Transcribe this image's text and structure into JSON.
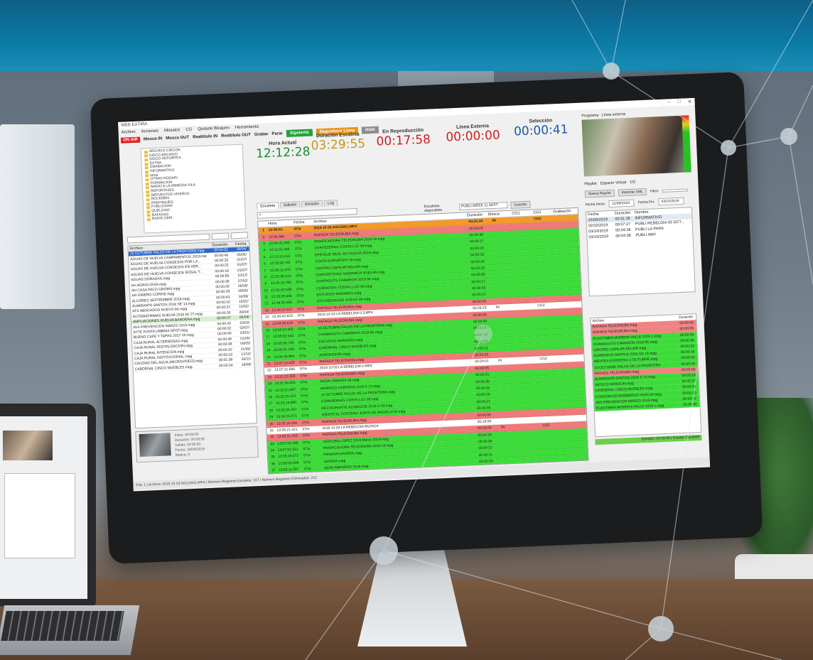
{
  "app": {
    "title": "WEB EXTIRA",
    "menu": [
      "Archivo",
      "Acciones",
      "Mosaico",
      "CG",
      "Quitarle Bloqueo",
      "Herramienta"
    ],
    "window_controls": [
      "–",
      "□",
      "✕"
    ]
  },
  "toolbar": {
    "onair": "ON AIR",
    "mosca_in": "Mosca IN",
    "mosca_out": "Mosca OUT",
    "realtitulo_in": "Realtitulo IN",
    "realtitulo_out": "Realtitulo OUT",
    "grabar": "Grabar",
    "parar": "Parar",
    "siguiente": "Siguiente",
    "reproducir_linea": "Reproducir Linea",
    "hold": "Hold"
  },
  "clocks": {
    "hora_actual": {
      "label": "Hora Actual",
      "value": "12:12:28",
      "color": "#1f8a2a"
    },
    "duracion_escaleta": {
      "label": "Duración Escaleta",
      "value": "03:29:55",
      "color": "#c7951a"
    },
    "en_reproduccion": {
      "label": "En Reproducción",
      "value": "00:17:58",
      "color": "#cc1f1f"
    },
    "linea_externa": {
      "label": "Línea Externa",
      "value": "00:00:00",
      "color": "#cc1f1f"
    },
    "seleccion": {
      "label": "Selección",
      "value": "00:00:41",
      "color": "#1a5aa6"
    }
  },
  "tree": [
    "ARCHIVO CIRCON",
    "DISCO ARCHIVO",
    "DISCO DEPORTES",
    "EXTRA",
    "GRABACION",
    "INFORMATIVO",
    "otros",
    "OTRAS ROGAIN",
    "PORMACION",
    "RADIO A LA ARMEDIA VILA",
    "REPORTAJES",
    "REPUESTOS VIVERUS",
    "ROCEMBO",
    "PREFINAJES",
    "PUBLICIDAD",
    "QUELIDAD",
    "RAFAGAS",
    "RADIO GEM"
  ],
  "left_list": {
    "headers": [
      "Archivo",
      "Duración",
      "Fecha"
    ],
    "rows": [
      {
        "name": "10 OCTUBRE PALOS DE LA FRONTERA.mpg",
        "dur": "00:00:50",
        "date": "29/04/",
        "state": "sel"
      },
      {
        "name": "AGUAS DE HUELVA CAMPAMENTOS 2018.mp4",
        "dur": "00:00:48",
        "date": "05/05/",
        "state": ""
      },
      {
        "name": "AGUAS DE HUELVA CONSEJOS POR LA...",
        "dur": "00:00:32",
        "date": "01/07/",
        "state": ""
      },
      {
        "name": "AGUAS DE HUELVA CONSEJOS EN VER...",
        "dur": "00:00:22",
        "date": "01/07/",
        "state": ""
      },
      {
        "name": "AGUAS DE HUELVA CONSEJOS ROSAL T...",
        "dur": "00:00:18",
        "date": "01/07/",
        "state": ""
      },
      {
        "name": "AGUAS DORADAS.mpg",
        "dur": "00:00:59",
        "date": "10/12/",
        "state": ""
      },
      {
        "name": "AH AGROLOGIA.mpg",
        "dur": "00:00:38",
        "date": "27/02/",
        "state": ""
      },
      {
        "name": "AH CASA PACO GROMS.mpg",
        "dur": "00:00:26",
        "date": "05/05/",
        "state": ""
      },
      {
        "name": "AH GINERO CORKIE.mpg",
        "dur": "00:00:29",
        "date": "05/05/",
        "state": ""
      },
      {
        "name": "ALCORES SEPTIEMBRE 2018.mpg",
        "dur": "00:00:43",
        "date": "16/09/",
        "state": ""
      },
      {
        "name": "ALMIRANTA SANTOS 2016 SE 14.mpg",
        "dur": "00:00:16",
        "date": "15/02/",
        "state": ""
      },
      {
        "name": "ATS ABOGADOS NUEVO 9K.mpg",
        "dur": "00:00:21",
        "date": "10/02/",
        "state": ""
      },
      {
        "name": "AUTOMATRIMAS HUELVA 2016 AV 27.mpg",
        "dur": "00:00:30",
        "date": "20/04/",
        "state": ""
      },
      {
        "name": "AMPLIACIONES HUELVA BANDERA.mpg",
        "dur": "00:00:27",
        "date": "06/04/",
        "state": "hl"
      },
      {
        "name": "AVS PREVENCION MARZO 2018.mpg",
        "dur": "00:00:42",
        "date": "15/03/",
        "state": ""
      },
      {
        "name": "AYTE PUNTA UMBRIA SPOT.mpg",
        "dur": "00:00:32",
        "date": "02/07/",
        "state": ""
      },
      {
        "name": "BUENO CAFE Y TAPAS 2017 VII.mpg",
        "dur": "00:00:40",
        "date": "23/01/",
        "state": ""
      },
      {
        "name": "CAJA RURAL ALTERNOSAS.mpg",
        "dur": "00:00:48",
        "date": "01/05/",
        "state": ""
      },
      {
        "name": "CAJA RURAL DIGITALIZACION.mpg",
        "dur": "00:00:38",
        "date": "06/05/",
        "state": ""
      },
      {
        "name": "CAJA RURAL INTENCION.mpg",
        "dur": "00:00:20",
        "date": "21/05/",
        "state": ""
      },
      {
        "name": "CAJA RURAL INSTITUCIONAL.mpg",
        "dur": "00:00:19",
        "date": "11/10/",
        "state": ""
      },
      {
        "name": "CALIDAD DEL AGUA (MICROVIDEO).mpg",
        "dur": "00:01:38",
        "date": "26/11/",
        "state": ""
      },
      {
        "name": "CARDENAL CINCO MUEBLES.mpg",
        "dur": "00:00:34",
        "date": "18/09/",
        "state": ""
      }
    ]
  },
  "preview": {
    "lines": [
      "Inicio: 00:00:00",
      "Duración: 00:00:50",
      "Salida: 00:00:50",
      "Fecha: 29/04/2019",
      "Mosca: 0"
    ]
  },
  "tabs": [
    "Escaleta",
    "Edición",
    "Emisión",
    "Log"
  ],
  "main_search": {
    "placeholder": "",
    "label": "Escaletas disponibles",
    "combo": "PUBLI-WEEK 11.SEPT",
    "button": "Guardar"
  },
  "grid": {
    "headers": [
      "",
      "Hora",
      "Fecha",
      "Archivo",
      "Duración",
      "Mosca",
      "CG1",
      "CG2",
      "Grabación"
    ],
    "rows": [
      {
        "n": "1",
        "h": "12:06:51",
        "f": "07/a",
        "a": "2019 10 03 A0112601.MP4",
        "d": "00:21:34",
        "m": "IN",
        "c1": "",
        "c2": "CG2",
        "g": "",
        "s": "orange"
      },
      {
        "n": "2",
        "h": "12:06:366",
        "f": "07/a",
        "a": "RAFAGA TELEONUBA.mpg",
        "d": "00:00:04",
        "m": "",
        "c1": "",
        "c2": "",
        "g": "",
        "s": "red"
      },
      {
        "n": "3",
        "h": "12:08:31.059",
        "f": "07/a",
        "a": "PANIFICADORA TELEONUBA 2018-19.mpg",
        "d": "00:00:36",
        "m": "",
        "c1": "",
        "c2": "",
        "g": "",
        "s": "green"
      },
      {
        "n": "4",
        "h": "12:11:01.406",
        "f": "07/a",
        "a": "CERVEZERAS COSTA LUZ 08.mpg",
        "d": "00:00:17",
        "m": "",
        "c1": "",
        "c2": "",
        "g": "",
        "s": "green"
      },
      {
        "n": "5",
        "h": "12:13:13.415",
        "f": "07/a",
        "a": "EPIFIDUE REAL DE HUELVA 2019.mpg",
        "d": "00:00:20",
        "m": "",
        "c1": "",
        "c2": "",
        "g": "",
        "s": "green"
      },
      {
        "n": "6",
        "h": "12:15:58.782",
        "f": "07/a",
        "a": "COSTA DORSPORT 09.mpg",
        "d": "00:00:32",
        "m": "",
        "c1": "",
        "c2": "",
        "g": "",
        "s": "green"
      },
      {
        "n": "7",
        "h": "12:20:11.075",
        "f": "07/a",
        "a": "CENTRO CAPILAR BELAIR.mpg",
        "d": "00:00:24",
        "m": "",
        "c1": "",
        "c2": "",
        "g": "",
        "s": "green"
      },
      {
        "n": "8",
        "h": "12:22:30.514",
        "f": "07/a",
        "a": "CONVERTIDOS SANDWICH HUELVA.mpg",
        "d": "00:00:23",
        "m": "",
        "c1": "",
        "c2": "",
        "g": "",
        "s": "green"
      },
      {
        "n": "9",
        "h": "12:25:18.795",
        "f": "07/a",
        "a": "CHAPAGUTS CAMARON 2018 9K.mpg",
        "d": "00:00:36",
        "m": "",
        "c1": "",
        "c2": "",
        "g": "",
        "s": "green"
      },
      {
        "n": "10",
        "h": "12:31:42.538",
        "f": "07/a",
        "a": "CORNISTAS COSTA LLUZ 09.mpg",
        "d": "00:00:17",
        "m": "",
        "c1": "",
        "c2": "",
        "g": "",
        "s": "green"
      },
      {
        "n": "11",
        "h": "12:33:28.646",
        "f": "07/a",
        "a": "ESTUDIOS MAÑANES.mpg",
        "d": "00:00:30",
        "m": "",
        "c1": "",
        "c2": "",
        "g": "",
        "s": "green"
      },
      {
        "n": "12",
        "h": "12:34:32.856",
        "f": "07/a",
        "a": "STO MEDIAGOS SUEXO 09.mpg",
        "d": "00:00:21",
        "m": "",
        "c1": "",
        "c2": "",
        "g": "",
        "s": "green"
      },
      {
        "n": "13",
        "h": "12:34:37.817",
        "f": "07/a",
        "a": "RAFAGA TELEONUBA.mpg",
        "d": "00:00:05",
        "m": "",
        "c1": "",
        "c2": "",
        "g": "",
        "s": "red"
      },
      {
        "n": "14",
        "h": "12:34:42.623",
        "f": "07/a",
        "a": "2019 10 03 LA REBELDIA 0 3.MP4",
        "d": "00:29:23",
        "m": "IN",
        "c1": "",
        "c2": "CG2",
        "g": "",
        "s": "white"
      },
      {
        "n": "15",
        "h": "13:04:05.616",
        "f": "07/a",
        "a": "RAFAGA TELEONUBA.mpg",
        "d": "00:00:05",
        "m": "",
        "c1": "",
        "c2": "",
        "g": "",
        "s": "red"
      },
      {
        "n": "16",
        "h": "13:04:13.405",
        "f": "07/a",
        "a": "10 OCTUBRE PALOS DE LA FRONTERA.mpg",
        "d": "00:00:49",
        "m": "",
        "c1": "",
        "c2": "",
        "g": "",
        "s": "green"
      },
      {
        "n": "17",
        "h": "13:05:02.543",
        "f": "07/a",
        "a": "CHAMAGUTS CAMARON 2018 9K.mpg",
        "d": "00:00:36",
        "m": "",
        "c1": "",
        "c2": "",
        "g": "",
        "s": "green"
      },
      {
        "n": "18",
        "h": "13:05:38.728",
        "f": "07/a",
        "a": "ESCUDOS MAÑANES.mpg",
        "d": "00:00:23",
        "m": "",
        "c1": "",
        "c2": "",
        "g": "",
        "s": "green"
      },
      {
        "n": "19",
        "h": "13:06:01.246",
        "f": "07/a",
        "a": "CARDENAL CINCO MUEBLES.mpg",
        "d": "00:00:34",
        "m": "",
        "c1": "",
        "c2": "",
        "g": "",
        "s": "green"
      },
      {
        "n": "20",
        "h": "13:06:35.994",
        "f": "07/a",
        "a": "AVIRONSERA.mpg",
        "d": "00:00:21",
        "m": "",
        "c1": "",
        "c2": "",
        "g": "",
        "s": "green"
      },
      {
        "n": "21",
        "h": "13:07:14.635",
        "f": "07/a",
        "a": "RAFAGA TELEONUBA.mpg",
        "d": "00:00:05",
        "m": "",
        "c1": "",
        "c2": "",
        "g": "",
        "s": "red"
      },
      {
        "n": "22",
        "h": "13:07:21.586",
        "f": "07/a",
        "a": "2019 10 03 LA REBELDIA 0 MP4",
        "d": "00:24:01",
        "m": "IN",
        "c1": "",
        "c2": "CG2",
        "g": "",
        "s": "white"
      },
      {
        "n": "23",
        "h": "13:31:22.355",
        "f": "07/a",
        "a": "RAFAGA TELEONUBA.mpg",
        "d": "00:00:05",
        "m": "",
        "c1": "",
        "c2": "",
        "g": "",
        "s": "red"
      },
      {
        "n": "24",
        "h": "13:31:30.601",
        "f": "07/a",
        "a": "MOVA UMANDA 09.mpg",
        "d": "00:00:21",
        "m": "",
        "c1": "",
        "c2": "",
        "g": "",
        "s": "green"
      },
      {
        "n": "25",
        "h": "13:31:51.867",
        "f": "07/a",
        "a": "MARISCO CARPENA 2018 S 13.mpg",
        "d": "00:00:35",
        "m": "",
        "c1": "",
        "c2": "",
        "g": "",
        "s": "green"
      },
      {
        "n": "26",
        "h": "13:32:26.151",
        "f": "07/a",
        "a": "10 OCTUBRE PALOS DE LA FRONTERA.mpg",
        "d": "00:00:49",
        "m": "",
        "c1": "",
        "c2": "",
        "g": "",
        "s": "green"
      },
      {
        "n": "27",
        "h": "13:33:16.880",
        "f": "07/a",
        "a": "COMANDINAS COSTA LUZ 09.mpg",
        "d": "00:00:18",
        "m": "",
        "c1": "",
        "c2": "",
        "g": "",
        "s": "green"
      },
      {
        "n": "28",
        "h": "13:33:34.307",
        "f": "07/a",
        "a": "RESTAURANTE AZABACHE 2018 S 03.mpg",
        "d": "00:00:21",
        "m": "",
        "c1": "",
        "c2": "",
        "g": "",
        "s": "green"
      },
      {
        "n": "29",
        "h": "13:34:15.071",
        "f": "07/a",
        "a": "DIENTE EL COSTERO JUNTA DE ANDALUCIA.mpg",
        "d": "00:00:35",
        "m": "",
        "c1": "",
        "c2": "",
        "g": "",
        "s": "green"
      },
      {
        "n": "30",
        "h": "13:35:16.006",
        "f": "07/a",
        "a": "RAFAGA TELEONUBA.mpg",
        "d": "00:00:05",
        "m": "",
        "c1": "",
        "c2": "",
        "g": "",
        "s": "red"
      },
      {
        "n": "31",
        "h": "13:35:21.321",
        "f": "07/a",
        "a": "2019 10 03 LA REBELDIA-MUSICA",
        "d": "00:19:59",
        "m": "",
        "c1": "",
        "c2": "",
        "g": "",
        "s": "white"
      },
      {
        "n": "32",
        "h": "13:55:21.319",
        "f": "07/a",
        "a": "RAFAGA TELEONUBA.mpg",
        "d": "00:02:05",
        "m": "IN",
        "c1": "",
        "c2": "CG2",
        "g": "",
        "s": "red"
      },
      {
        "n": "33",
        "h": "13:57:26.338",
        "f": "07/a",
        "a": "VENTURA LOPEZ 2019 Marzo 2019.mpg",
        "d": "00:00:26",
        "m": "",
        "c1": "",
        "c2": "",
        "g": "",
        "s": "green"
      },
      {
        "n": "34",
        "h": "13:57:52.561",
        "f": "07/a",
        "a": "PANIFICADORA TELEONUBA 2018-19.mpg",
        "d": "00:00:36",
        "m": "",
        "c1": "",
        "c2": "",
        "g": "",
        "s": "green"
      },
      {
        "n": "35",
        "h": "13:58:28.672",
        "f": "07/a",
        "a": "PANADAYSAVERA.mpg",
        "d": "00:00:22",
        "m": "",
        "c1": "",
        "c2": "",
        "g": "",
        "s": "green"
      },
      {
        "n": "36",
        "h": "13:58:50.684",
        "f": "07/a",
        "a": "SAYERA.mpg",
        "d": "00:00:21",
        "m": "",
        "c1": "",
        "c2": "",
        "g": "",
        "s": "green"
      },
      {
        "n": "37",
        "h": "13:59:11.587",
        "f": "07/a",
        "a": "SEAR ABRAROS 2018.mpg",
        "d": "00:00:23",
        "m": "",
        "c1": "",
        "c2": "",
        "g": "",
        "s": "green"
      },
      {
        "n": "38",
        "h": "13:59:34.592",
        "f": "07/a",
        "a": "RAFAGA TELEONUBA.mpg",
        "d": "00:00:05",
        "m": "",
        "c1": "",
        "c2": "",
        "g": "",
        "s": "red"
      }
    ]
  },
  "status_bar": "Fila: 1 | Archivo: 2019 10 03 A0112601.MP4 | Número Registros Escaleta: 107 | Número Registros Eliminados: 212",
  "right_panel": {
    "tabs": [
      "Programa",
      "Línea externa"
    ],
    "tabs2": [
      "Playlist",
      "Espacio Virtual",
      "CG"
    ],
    "ctrl_buttons": [
      "Nueva Playlist",
      "Importar XML"
    ],
    "filter_label": "Filtro:",
    "from_label": "Fecha Inicio:",
    "from_value": "12/09/2019",
    "to_label": "Fecha Fin:",
    "to_value": "03/10/2019",
    "playlist_headers": [
      "Fecha",
      "Duración",
      "Nombre"
    ],
    "playlist_rows": [
      {
        "f": "25/09/2019",
        "d": "00:01:36",
        "n": "INFORMATIVO"
      },
      {
        "f": "02/10/2019",
        "d": "00:07:27",
        "n": "PUBLI REBELDIA 03 OCT..."
      },
      {
        "f": "03/10/2019",
        "d": "00:04:38",
        "n": "PUBLI LA PARA"
      },
      {
        "f": "03/10/2019",
        "d": "00:04:38",
        "n": "PUBLI ABH"
      }
    ],
    "archive_headers": [
      "Archivo",
      "Duración"
    ],
    "archive_rows": [
      {
        "a": "RAFAGA TELEONUBA.mpg",
        "d": "00:00:05",
        "s": "red"
      },
      {
        "a": "RAFAGA TELEONUBA.mpg",
        "d": "00:00:05",
        "s": "red"
      },
      {
        "a": "PLASTIMER MORERA VALLE 2019 1.mpg",
        "d": "00:00:30",
        "s": "green"
      },
      {
        "a": "CHAMAGUTS CAMARON 2018 9K.mpg",
        "d": "00:00:36",
        "s": "green"
      },
      {
        "a": "CENTRO CAPILAR BELAIR.mpg",
        "d": "00:00:24",
        "s": "green"
      },
      {
        "a": "ALMIRANTA SANTOS 2016 SE 14.mpg",
        "d": "00:00:16",
        "s": "green"
      },
      {
        "a": "MENTES EXPERTAS 2 OCTUBRE.mpg",
        "d": "00:00:33",
        "s": "green"
      },
      {
        "a": "10 OCTUBRE PALOS DE LA FRONTERA",
        "d": "00:00:49",
        "s": "green"
      },
      {
        "a": "RAFAGA TELEONUBA.mpg",
        "d": "00:00:05",
        "s": "red"
      },
      {
        "a": "ALMIRANTA SANTOS 2016 S 14.mpg",
        "d": "00:00:16",
        "s": "green"
      },
      {
        "a": "INDSCO MANOLIN.mpg",
        "d": "00:00:27",
        "s": "green"
      },
      {
        "a": "CARDENAL CINCO MUEBLES.mpg",
        "d": "00:00:34",
        "s": "green"
      },
      {
        "a": "CONSORCIO BOMBEROS HUELVA.mpg",
        "d": "00:00:20",
        "s": "green"
      },
      {
        "a": "AVS PREVENCION MARZO 2018.mpg",
        "d": "00:00:42",
        "s": "green"
      },
      {
        "a": "PLASTIMER MORERA VALLE 2019 1.mpg",
        "d": "00:00:30",
        "s": "green"
      }
    ],
    "status": "Emisión: 00:00:00 | Estado: Escaleta"
  }
}
